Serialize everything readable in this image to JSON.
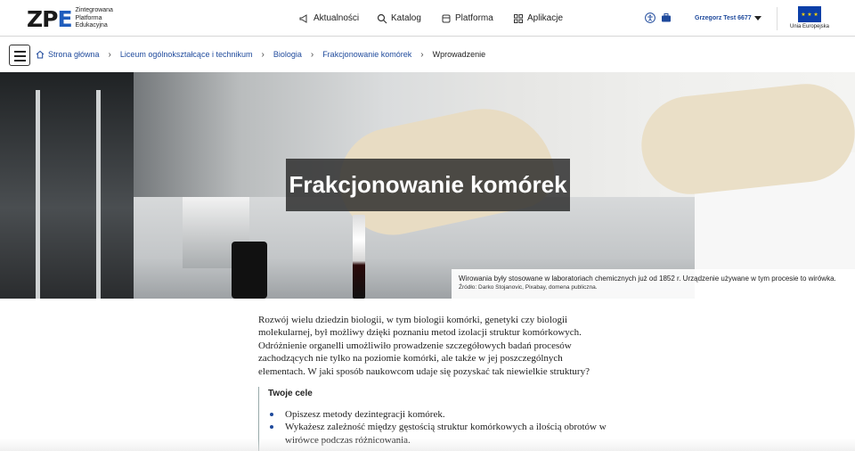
{
  "header": {
    "logo_mark": "ZP",
    "logo_mark_e": "E",
    "logo_text": [
      "Zintegrowana",
      "Platforma",
      "Edukacyjna"
    ],
    "nav": [
      {
        "label": "Aktualności",
        "icon": "megaphone-icon"
      },
      {
        "label": "Katalog",
        "icon": "search-icon"
      },
      {
        "label": "Platforma",
        "icon": "cap-icon"
      },
      {
        "label": "Aplikacje",
        "icon": "grid-icon"
      }
    ],
    "user": "Grzegorz Test 6677",
    "eu_label": "Unia Europejska"
  },
  "breadcrumb": [
    {
      "label": "Strona główna"
    },
    {
      "label": "Liceum ogólnokształcące i technikum"
    },
    {
      "label": "Biologia"
    },
    {
      "label": "Frakcjonowanie komórek"
    },
    {
      "label": "Wprowadzenie"
    }
  ],
  "hero": {
    "title": "Frakcjonowanie komórek",
    "caption_main": "Wirowania były stosowane w laboratoriach chemicznych już od 1852 r. Urządzenie używane w tym procesie to wirówka.",
    "caption_source": "Źródło: Darko Stojanovic, Pixabay, domena publiczna."
  },
  "article": {
    "intro_lines": [
      "Rozwój wielu dziedzin biologii, w tym biologii komórki, genetyki czy biologii",
      "molekularnej, był możliwy dzięki poznaniu metod izolacji struktur komórkowych.",
      "Odróżnienie organelli umożliwiło prowadzenie szczegółowych badań procesów",
      "zachodzących nie tylko na poziomie komórki, ale także w jej poszczególnych",
      "elementach. W jaki sposób naukowcom udaje się pozyskać tak niewielkie struktury?"
    ],
    "goals_title": "Twoje cele",
    "goals": [
      "Opiszesz metody dezintegracji komórek.",
      "Wykażesz zależność między gęstością struktur komórkowych a ilością obrotów w wirówce podczas różnicowania."
    ]
  },
  "colors": {
    "link": "#1f4a9c",
    "accent": "#1f5dbd",
    "eu_blue": "#0b3fa8"
  }
}
